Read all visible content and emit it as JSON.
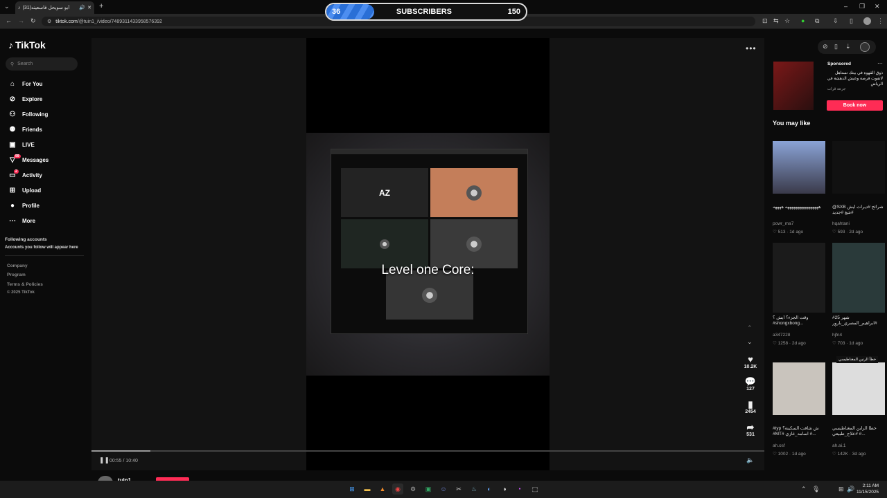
{
  "browser": {
    "tab_title": "(31)أبو سويحل  فاسعينه",
    "new_tab_label": "+",
    "url_domain": "tiktok.com",
    "url_path": "/@tuin1_/video/7489311433958576392"
  },
  "overlay": {
    "left_value": "36",
    "label": "SUBSCRIBERS",
    "right_value": "150",
    "progress_fraction": 0.24
  },
  "sidebar": {
    "logo_text": "TikTok",
    "search_placeholder": "Search",
    "nav": [
      {
        "label": "For You",
        "icon": "home-icon"
      },
      {
        "label": "Explore",
        "icon": "compass-icon"
      },
      {
        "label": "Following",
        "icon": "user-follow-icon"
      },
      {
        "label": "Friends",
        "icon": "friends-icon"
      },
      {
        "label": "LIVE",
        "icon": "live-icon"
      },
      {
        "label": "Messages",
        "icon": "messages-icon",
        "badge": "99"
      },
      {
        "label": "Activity",
        "icon": "activity-icon",
        "badge": "2"
      },
      {
        "label": "Upload",
        "icon": "upload-icon"
      },
      {
        "label": "Profile",
        "icon": "avatar"
      },
      {
        "label": "More",
        "icon": "more-icon"
      }
    ],
    "following_title": "Following accounts",
    "following_hint": "Accounts you follow will appear here",
    "footer": [
      "Company",
      "Program",
      "Terms & Policies",
      "© 2025 TikTok"
    ]
  },
  "video": {
    "caption": "Level one Core:",
    "tile_logo": "AZ",
    "time": "00:55 / 10:40",
    "progress_fraction": 0.088,
    "author": "tuin1"
  },
  "actions": {
    "likes": "10.2K",
    "comments": "127",
    "saves": "2454",
    "shares": "531"
  },
  "sponsored": {
    "label": "Sponsored",
    "text": "ذوق القهوة في بيتك تستاهل لاتفوت فرصة وعيش الدهشة في الرياض",
    "brand": "جرعة قرات",
    "cta": "Book now"
  },
  "you_may_like": {
    "title": "You may like",
    "items": [
      {
        "caption": "ههههههههههههههههه ههههه",
        "user": "powr_ma7",
        "likes": "513",
        "age": "1d ago"
      },
      {
        "caption": "@SXB شرائح #ديرات أيش #شغ #جديد",
        "user": "hqahtani",
        "likes": "593",
        "age": "2d ago"
      },
      {
        "caption": "وقت الجزء؟ أيش ؟ #shongxbong...",
        "user": "a347228",
        "likes": "1258",
        "age": "2d ago"
      },
      {
        "caption": "#25 شهر #ابراهيم_المصري_بارور #تيك",
        "user": "hjfn4",
        "likes": "703",
        "age": "1d ago"
      },
      {
        "caption": "#typ ش شافت السكينة؟ #MT# اسامه_غازي #...",
        "user": "ah.osf",
        "likes": "1002",
        "age": "1d ago"
      },
      {
        "caption": "خطأ الراين المغناطيسي #علاج_طبيعي #...",
        "user": "ah.ai.1",
        "likes": "142K",
        "age": "3d ago"
      }
    ],
    "overlay_text": "خطأ الرنين المغناطيسي"
  },
  "taskbar": {
    "time": "2:11 AM",
    "date": "11/15/2025"
  },
  "colors": {
    "accent": "#fe2c55",
    "bg": "#0b0b0b",
    "player": "#131313"
  }
}
